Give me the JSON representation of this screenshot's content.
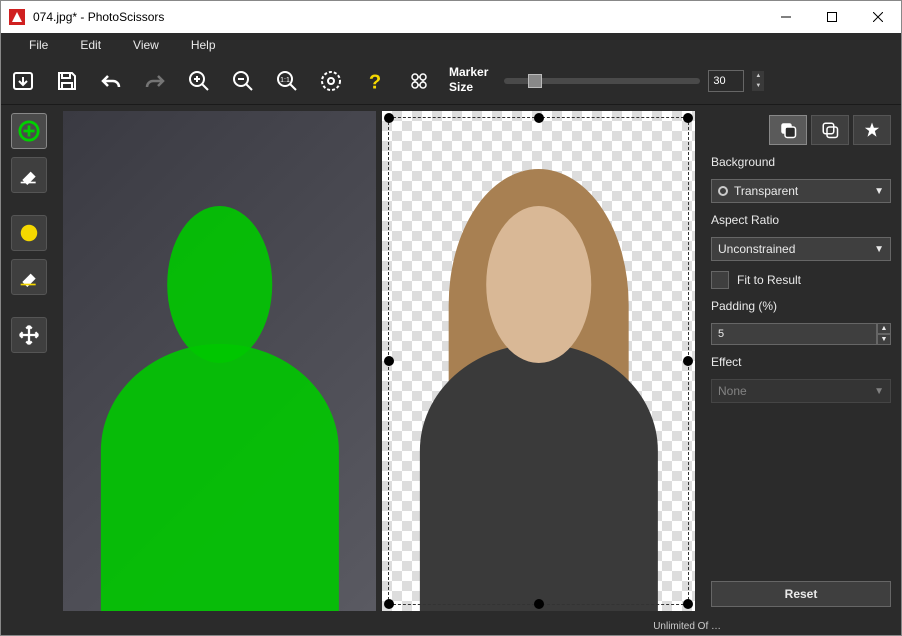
{
  "window": {
    "title": "074.jpg* - PhotoScissors"
  },
  "menubar": [
    "File",
    "Edit",
    "View",
    "Help"
  ],
  "toolbar": {
    "marker_label_1": "Marker",
    "marker_label_2": "Size",
    "marker_size": "30"
  },
  "sidebar": {
    "tools": [
      {
        "name": "add-foreground-tool",
        "icon": "plus-green"
      },
      {
        "name": "eraser-foreground-tool",
        "icon": "eraser"
      },
      {
        "name": "add-background-tool",
        "icon": "circle-yellow"
      },
      {
        "name": "eraser-background-tool",
        "icon": "eraser-yellow"
      },
      {
        "name": "move-tool",
        "icon": "move"
      }
    ]
  },
  "panel": {
    "section_background": "Background",
    "background_value": "Transparent",
    "section_aspect": "Aspect Ratio",
    "aspect_value": "Unconstrained",
    "fit_label": "Fit to Result",
    "section_padding": "Padding (%)",
    "padding_value": "5",
    "section_effect": "Effect",
    "effect_value": "None",
    "reset_label": "Reset"
  },
  "status": {
    "text": "Unlimited Of …"
  }
}
